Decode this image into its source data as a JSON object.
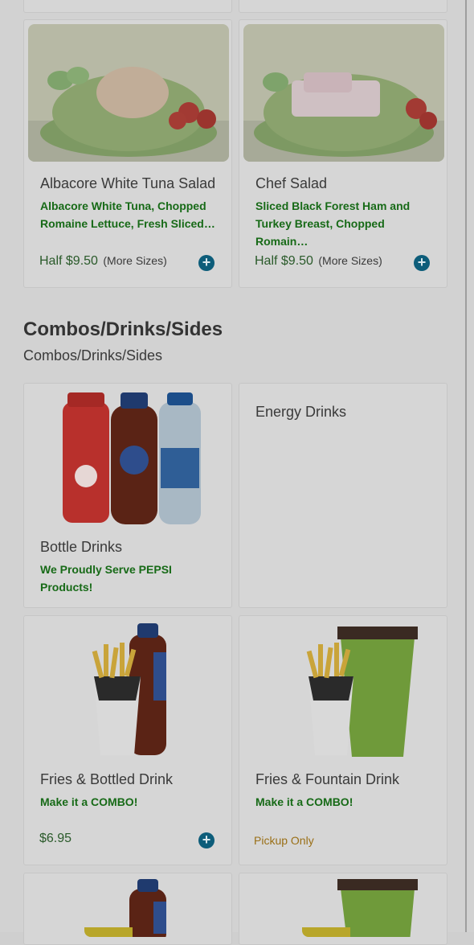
{
  "salads": [
    {
      "name": "Albacore White Tuna Salad",
      "desc": "Albacore White Tuna, Chopped Romaine Lettuce, Fresh Sliced…",
      "price": "Half $9.50",
      "more": "(More Sizes)"
    },
    {
      "name": "Chef Salad",
      "desc": "Sliced Black Forest Ham and Turkey Breast, Chopped Romain…",
      "price": "Half $9.50",
      "more": "(More Sizes)"
    }
  ],
  "section": {
    "title": "Combos/Drinks/Sides",
    "subtitle": "Combos/Drinks/Sides"
  },
  "combo_items": [
    {
      "name": "Bottle Drinks",
      "desc": "We Proudly Serve PEPSI Products!"
    },
    {
      "name": "Energy Drinks"
    },
    {
      "name": "Fries & Bottled Drink",
      "desc": "Make it a COMBO!",
      "price": "$6.95"
    },
    {
      "name": "Fries & Fountain Drink",
      "desc": "Make it a COMBO!",
      "pickup": "Pickup Only"
    }
  ],
  "icons": {
    "add": "plus-circle-icon"
  },
  "colors": {
    "accent": "#0d5d7a",
    "desc_green": "#176a17",
    "pickup": "#9a6f16"
  }
}
